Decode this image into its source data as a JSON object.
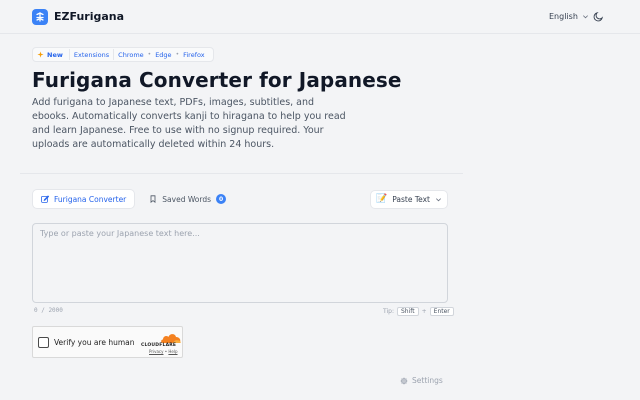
{
  "header": {
    "brand": "EZFurigana",
    "language": "English"
  },
  "badges": {
    "new_label": "New",
    "items": [
      "Extensions",
      "Chrome",
      "Edge",
      "Firefox"
    ]
  },
  "hero": {
    "title": "Furigana Converter for Japanese",
    "description": "Add furigana to Japanese text, PDFs, images, subtitles, and ebooks. Automatically converts kanji to hiragana to help you read and learn Japanese. Free to use with no signup required. Your uploads are automatically deleted within 24 hours."
  },
  "tabs": {
    "converter": "Furigana Converter",
    "saved": "Saved Words",
    "saved_count": "0"
  },
  "paste": {
    "label": "Paste Text",
    "emoji": "📝"
  },
  "input": {
    "placeholder": "Type or paste your Japanese text here...",
    "counter": "0 / 2000"
  },
  "tip": {
    "label": "Tip:",
    "key1": "Shift",
    "plus": "+",
    "key2": "Enter"
  },
  "captcha": {
    "label": "Verify you are human",
    "provider": "CLOUDFLARE",
    "privacy": "Privacy",
    "separator": "•",
    "help": "Help"
  },
  "settings": {
    "label": "Settings"
  },
  "colors": {
    "accent": "#3b82f6",
    "cloudflare": "#f48120"
  }
}
